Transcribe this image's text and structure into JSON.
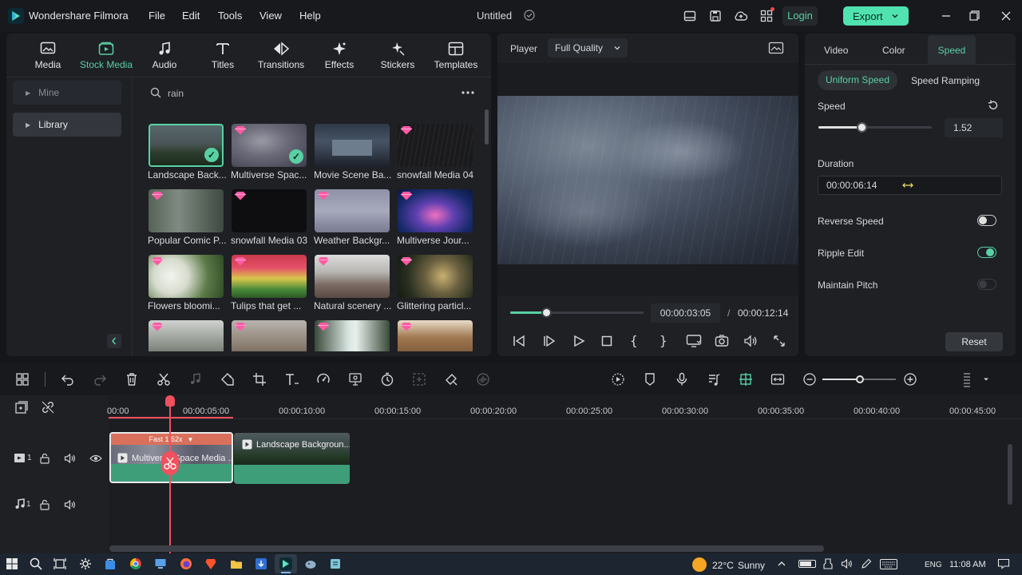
{
  "app": {
    "title": "Wondershare Filmora",
    "project": "Untitled"
  },
  "menu": [
    "File",
    "Edit",
    "Tools",
    "View",
    "Help"
  ],
  "header": {
    "login": "Login",
    "export": "Export"
  },
  "media_tabs": [
    {
      "label": "Media",
      "icon": "media-icon"
    },
    {
      "label": "Stock Media",
      "icon": "stock-media-icon"
    },
    {
      "label": "Audio",
      "icon": "audio-icon"
    },
    {
      "label": "Titles",
      "icon": "titles-icon"
    },
    {
      "label": "Transitions",
      "icon": "transitions-icon"
    },
    {
      "label": "Effects",
      "icon": "effects-icon"
    },
    {
      "label": "Stickers",
      "icon": "stickers-icon"
    },
    {
      "label": "Templates",
      "icon": "templates-icon"
    }
  ],
  "active_media_tab": "Stock Media",
  "library_nav": {
    "mine": "Mine",
    "library": "Library"
  },
  "search": {
    "value": "rain"
  },
  "thumbnails": [
    {
      "label": "Landscape Back...",
      "premium": false,
      "added": true
    },
    {
      "label": "Multiverse Spac...",
      "premium": true,
      "added": true
    },
    {
      "label": "Movie Scene Ba...",
      "premium": false,
      "added": false
    },
    {
      "label": "snowfall Media 04",
      "premium": true,
      "added": false
    },
    {
      "label": "Popular Comic P...",
      "premium": true,
      "added": false
    },
    {
      "label": "snowfall Media 03",
      "premium": true,
      "added": false
    },
    {
      "label": "Weather Backgr...",
      "premium": true,
      "added": false
    },
    {
      "label": "Multiverse Jour...",
      "premium": true,
      "added": false
    },
    {
      "label": "Flowers bloomi...",
      "premium": true,
      "added": false
    },
    {
      "label": "Tulips that get ...",
      "premium": true,
      "added": false
    },
    {
      "label": "Natural scenery ...",
      "premium": true,
      "added": false
    },
    {
      "label": "Glittering particl...",
      "premium": true,
      "added": false
    },
    {
      "label": "",
      "premium": true,
      "added": false
    },
    {
      "label": "",
      "premium": true,
      "added": false
    },
    {
      "label": "",
      "premium": true,
      "added": false
    },
    {
      "label": "",
      "premium": true,
      "added": false
    }
  ],
  "player": {
    "label": "Player",
    "quality": "Full Quality",
    "current_time": "00:00:03:05",
    "separator": "/",
    "total_time": "00:00:12:14",
    "progress": 0.27
  },
  "properties": {
    "tabs": [
      "Video",
      "Color",
      "Speed"
    ],
    "active_tab": "Speed",
    "subtabs": [
      "Uniform Speed",
      "Speed Ramping"
    ],
    "speed_label": "Speed",
    "speed_value": "1.52",
    "speed_slider": 0.38,
    "duration_label": "Duration",
    "duration_value": "00:00:06:14",
    "reverse_speed": "Reverse Speed",
    "ripple_edit": "Ripple Edit",
    "maintain_pitch": "Maintain Pitch",
    "reset": "Reset"
  },
  "timeline": {
    "ruler": [
      "00:00",
      "00:00:05:00",
      "00:00:10:00",
      "00:00:15:00",
      "00:00:20:00",
      "00:00:25:00",
      "00:00:30:00",
      "00:00:35:00",
      "00:00:40:00",
      "00:00:45:00"
    ],
    "clip1": {
      "label": "Multiverse Space Media ...",
      "speed_badge": "Fast 1.52x"
    },
    "clip2": {
      "label": "Landscape Backgroun..."
    },
    "track_video_no": "1",
    "track_audio_no": "1"
  },
  "taskbar": {
    "weather_temp": "22°C",
    "weather_desc": "Sunny",
    "lang": "ENG",
    "time": "11:08 AM"
  },
  "colors": {
    "accent": "#58d0a3",
    "playhead": "#f0505f",
    "clip_green": "#3f9e7a",
    "clip_badge": "#d9705c",
    "export_bg": "#50e3b0"
  }
}
